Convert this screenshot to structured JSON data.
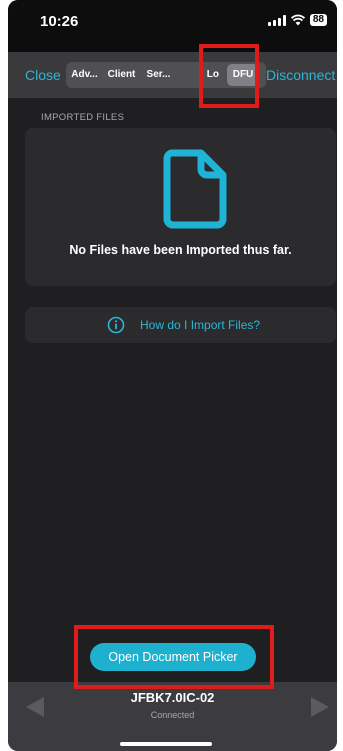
{
  "status_bar": {
    "time": "10:26",
    "battery": "88"
  },
  "nav": {
    "close_label": "Close",
    "tabs": [
      {
        "label": "Adv..."
      },
      {
        "label": "Client"
      },
      {
        "label": "Ser..."
      },
      {
        "label": "Lo"
      },
      {
        "label": "DFU",
        "selected": true
      }
    ],
    "disconnect_label": "Disconnect"
  },
  "imported_files": {
    "section_title": "IMPORTED FILES",
    "empty_message": "No Files have been Imported thus far."
  },
  "help": {
    "label": "How do I Import Files?"
  },
  "actions": {
    "open_picker_label": "Open Document Picker"
  },
  "device": {
    "name": "JFBK7.0IC-02",
    "status": "Connected"
  },
  "colors": {
    "accent": "#2ab6d6",
    "highlight": "#e01b1b",
    "background": "#1f1f21"
  },
  "icons": [
    "signal-icon",
    "wifi-icon",
    "battery-icon",
    "document-icon",
    "info-icon",
    "chevron-left-icon",
    "chevron-right-icon"
  ]
}
